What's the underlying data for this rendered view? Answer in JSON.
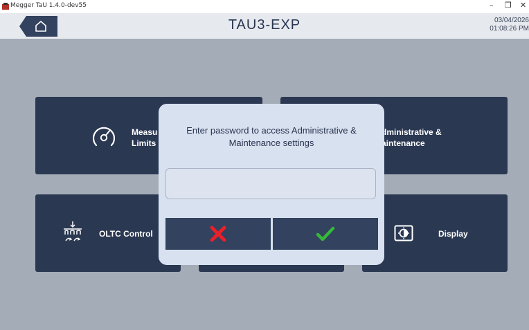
{
  "window": {
    "title": "Megger TaU 1.4.0-dev55",
    "controls": [
      "–",
      "❐",
      "✕"
    ]
  },
  "header": {
    "title": "TAU3-EXP",
    "date": "03/04/2026",
    "time": "01:08:26 PM",
    "home_icon": "home-icon"
  },
  "tiles": [
    {
      "label_line1": "Measu",
      "label_line2": "Limits",
      "icon": "gauge-icon"
    },
    {
      "label_line1": "dministrative &",
      "label_line2": "aintenance"
    },
    {
      "label": "OLTC Control",
      "icon": "oltc-icon"
    },
    {
      "label": "Display",
      "icon": "display-icon"
    }
  ],
  "dialog": {
    "prompt": "Enter password to access Administrative & Maintenance settings",
    "password_value": "",
    "cancel_icon": "close-icon",
    "confirm_icon": "check-icon",
    "colors": {
      "cancel": "#e8202a",
      "confirm": "#36b83a"
    }
  },
  "colors": {
    "background": "#a4acb8",
    "tile": "#2b3852",
    "header": "#e6e9ee"
  }
}
